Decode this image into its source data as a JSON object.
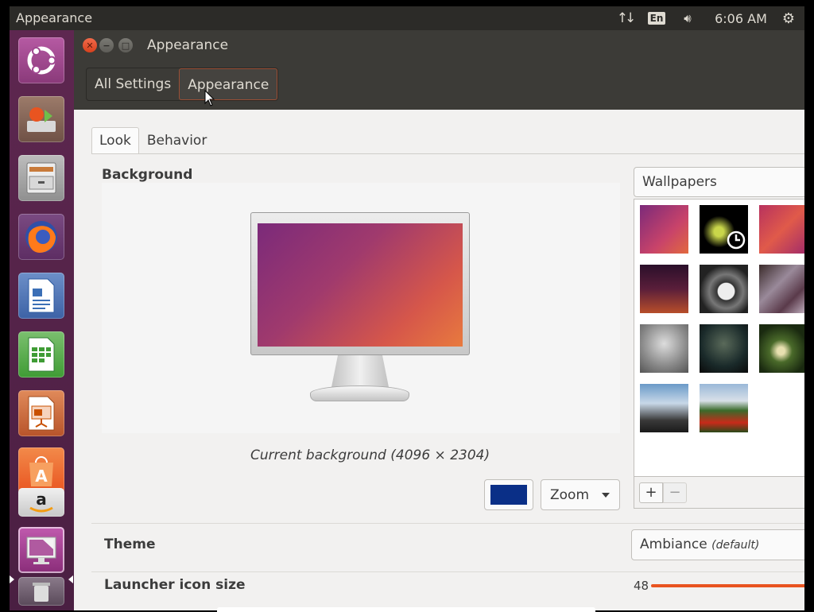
{
  "panel": {
    "title": "Appearance",
    "network_icon": "network-transfer-icon",
    "keyboard_layout": "En",
    "volume_icon": "volume-icon",
    "clock": "6:06 AM",
    "settings_icon": "gear-icon",
    "bg_color": "#2c2b28"
  },
  "launcher": {
    "bg_color": "#5e2750",
    "items": [
      {
        "name": "ubuntu-dash",
        "icon": "ubuntu-logo-icon",
        "color": "#a0508f"
      },
      {
        "name": "software-updater",
        "icon": "software-updater-icon",
        "color": "#8a6a5a"
      },
      {
        "name": "files",
        "icon": "file-cabinet-icon",
        "color": "#8c8c8c"
      },
      {
        "name": "firefox",
        "icon": "firefox-icon",
        "color": "#e66000"
      },
      {
        "name": "libreoffice-writer",
        "icon": "writer-icon",
        "color": "#3b6fb6"
      },
      {
        "name": "libreoffice-calc",
        "icon": "calc-icon",
        "color": "#3f9c35"
      },
      {
        "name": "libreoffice-impress",
        "icon": "impress-icon",
        "color": "#c85000"
      },
      {
        "name": "ubuntu-software",
        "icon": "shopping-bag-icon",
        "color": "#e95420"
      },
      {
        "name": "amazon",
        "icon": "amazon-icon",
        "color": "#d8d8d8"
      },
      {
        "name": "system-settings",
        "icon": "display-settings-icon",
        "color": "#a23b8f"
      },
      {
        "name": "trash",
        "icon": "trash-icon",
        "color": "#7a6a7a"
      }
    ]
  },
  "window": {
    "title": "Appearance",
    "breadcrumb": {
      "all_settings": "All Settings",
      "current": "Appearance"
    },
    "tabs": {
      "look": "Look",
      "behavior": "Behavior"
    },
    "background": {
      "label": "Background",
      "caption": "Current background (4096 × 2304)",
      "color": "#0a2f87",
      "mode": "Zoom",
      "source": "Wallpapers",
      "add_label": "+",
      "remove_label": "−"
    },
    "theme": {
      "label": "Theme",
      "value": "Ambiance",
      "default_tag": "(default)"
    },
    "launcher_icon_size": {
      "label": "Launcher icon size",
      "value": "48"
    }
  },
  "accent_color": "#e95420"
}
